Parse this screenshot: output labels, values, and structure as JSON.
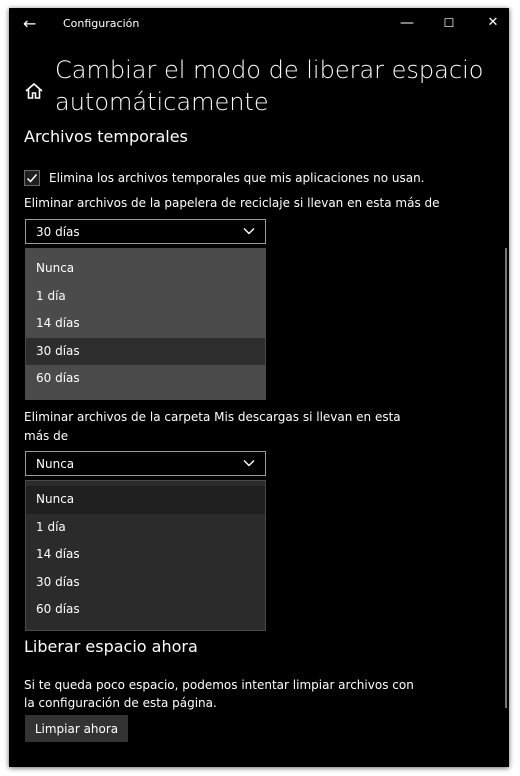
{
  "window": {
    "title": "Configuración",
    "back_icon": "arrow-left-icon",
    "minimize_symbol": "—",
    "maximize_symbol": "☐",
    "close_symbol": "✕"
  },
  "page": {
    "home_icon": "home-icon",
    "title": "Cambiar el modo de liberar espacio automáticamente"
  },
  "temp_files": {
    "heading": "Archivos temporales",
    "checkbox": {
      "label": "Elimina los archivos temporales que mis aplicaciones no usan.",
      "checked": true
    },
    "recycle_bin": {
      "label": "Eliminar archivos de la papelera de reciclaje si llevan en esta más de",
      "value": "30 días",
      "options": [
        "Nunca",
        "1 día",
        "14 días",
        "30 días",
        "60 días"
      ],
      "selected_index": 3
    },
    "downloads": {
      "label": "Eliminar archivos de la carpeta Mis descargas si llevan en esta más de",
      "value": "Nunca",
      "options": [
        "Nunca",
        "1 día",
        "14 días",
        "30 días",
        "60 días"
      ],
      "selected_index": 0
    }
  },
  "free_now": {
    "heading": "Liberar espacio ahora",
    "description": "Si te queda poco espacio, podemos intentar limpiar archivos con la configuración de esta página.",
    "button_label": "Limpiar ahora"
  },
  "colors": {
    "background": "#000000",
    "text": "#ffffff",
    "dropdown_light": "#4b4b4b",
    "dropdown_dark": "#2b2b2b",
    "button": "#333333"
  }
}
